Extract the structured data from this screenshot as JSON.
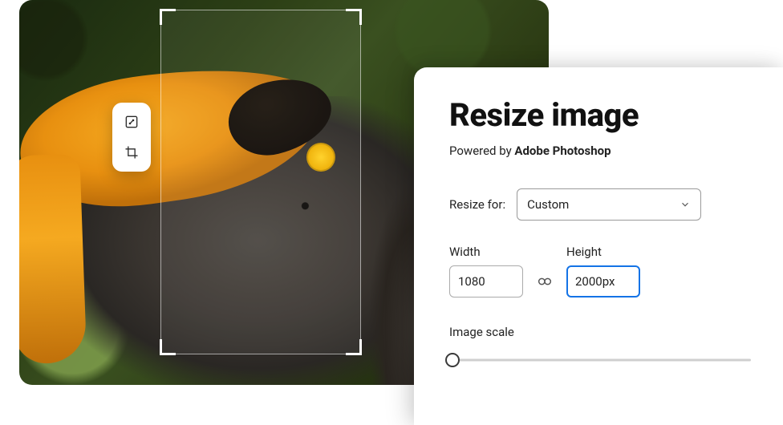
{
  "panel": {
    "title": "Resize image",
    "poweredPrefix": "Powered by ",
    "poweredBrand": "Adobe Photoshop",
    "resizeForLabel": "Resize for:",
    "resizeForValue": "Custom",
    "widthLabel": "Width",
    "widthValue": "1080",
    "heightLabel": "Height",
    "heightValue": "2000px",
    "scaleLabel": "Image scale"
  },
  "tools": {
    "resize": "resize",
    "crop": "crop"
  }
}
